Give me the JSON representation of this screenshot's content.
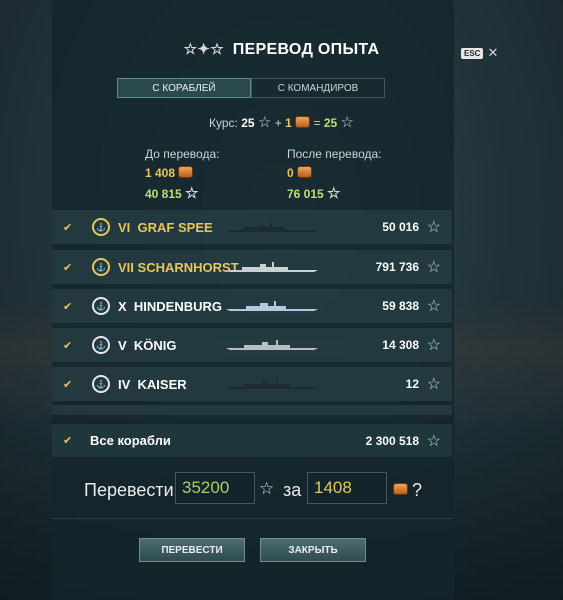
{
  "dialog": {
    "title": "ПЕРЕВОД ОПЫТА",
    "title_icon": "elite-xp-stars-icon",
    "esc_label": "ESC",
    "close_icon": "close-icon"
  },
  "tabs": [
    {
      "label": "С КОРАБЛЕЙ",
      "active": true
    },
    {
      "label": "С КОМАНДИРОВ",
      "active": false
    }
  ],
  "rate": {
    "label": "Курс:",
    "xp": "25",
    "plus": "+",
    "doubloons": "1",
    "equals": "=",
    "free_xp": "25"
  },
  "balance": {
    "before_label": "До перевода:",
    "before_doubloons": "1 408",
    "before_free_xp": "40 815",
    "after_label": "После перевода:",
    "after_doubloons": "0",
    "after_free_xp": "76 015"
  },
  "ships": [
    {
      "tier": "VI",
      "name": "GRAF SPEE",
      "xp": "50 016",
      "gold": true,
      "checked": true
    },
    {
      "tier": "VII",
      "name": "SCHARNHORST",
      "xp": "791 736",
      "gold": true,
      "checked": true
    },
    {
      "tier": "X",
      "name": "HINDENBURG",
      "xp": "59 838",
      "gold": false,
      "checked": true
    },
    {
      "tier": "V",
      "name": "KÖNIG",
      "xp": "14 308",
      "gold": false,
      "checked": true
    },
    {
      "tier": "IV",
      "name": "KAISER",
      "xp": "12",
      "gold": false,
      "checked": true
    }
  ],
  "all_ships": {
    "label": "Все корабли",
    "xp": "2 300 518",
    "checked": true
  },
  "convert": {
    "label_convert": "Перевести",
    "xp_value": "35200",
    "label_for": "за",
    "doubloons_value": "1408",
    "question": "?"
  },
  "buttons": {
    "convert": "ПЕРЕВЕСТИ",
    "close": "ЗАКРЫТЬ"
  },
  "colors": {
    "accent_gold": "#e9c65a",
    "free_xp_green": "#b7e07a",
    "panel_bg": "#14262c"
  }
}
